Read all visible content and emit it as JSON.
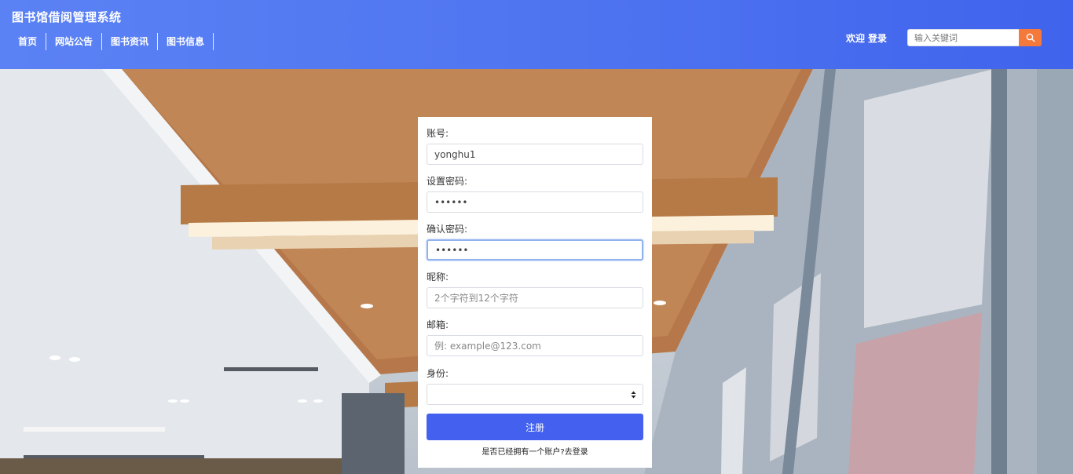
{
  "header": {
    "title": "图书馆借阅管理系统",
    "nav": [
      "首页",
      "网站公告",
      "图书资讯",
      "图书信息"
    ],
    "welcome": "欢迎",
    "login": "登录",
    "search_placeholder": "输入关键词"
  },
  "form": {
    "fields": [
      {
        "label": "账号:",
        "value": "yonghu1",
        "placeholder": ""
      },
      {
        "label": "设置密码:",
        "value": "••••••",
        "placeholder": ""
      },
      {
        "label": "确认密码:",
        "value": "••••••",
        "placeholder": ""
      },
      {
        "label": "昵称:",
        "value": "",
        "placeholder": "2个字符到12个字符"
      },
      {
        "label": "邮箱:",
        "value": "",
        "placeholder": "例: example@123.com"
      }
    ],
    "role_label": "身份:",
    "role_value": "",
    "submit": "注册",
    "login_link": "是否已经拥有一个账户?去登录"
  },
  "colors": {
    "header_bg": "#4d72f0",
    "search_button": "#f5793b",
    "submit_button": "#4361ee"
  }
}
